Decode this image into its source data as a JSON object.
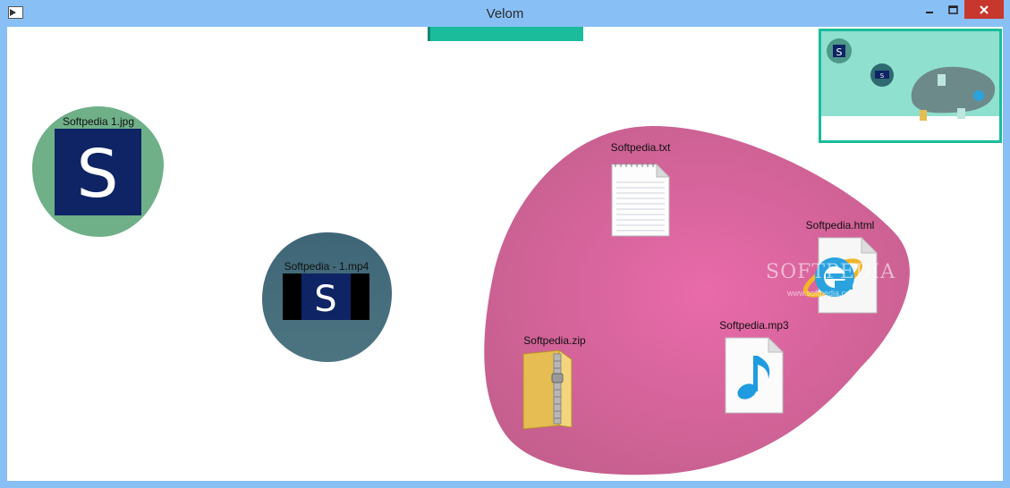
{
  "window": {
    "title": "Velom",
    "colors": {
      "titlebar": "#88bff5",
      "close": "#c7372e",
      "accent": "#1abc9c"
    }
  },
  "files": [
    {
      "name": "Softpedia 1.jpg",
      "icon": "jpg-image-thumbnail-icon",
      "group": "green-bubble"
    },
    {
      "name": "Softpedia - 1.mp4",
      "icon": "mp4-video-thumbnail-icon",
      "group": "teal-bubble"
    },
    {
      "name": "Softpedia.txt",
      "icon": "text-document-icon",
      "group": "pink-bubble"
    },
    {
      "name": "Softpedia.html",
      "icon": "internet-explorer-html-icon",
      "group": "pink-bubble"
    },
    {
      "name": "Softpedia.mp3",
      "icon": "music-note-file-icon",
      "group": "pink-bubble"
    },
    {
      "name": "Softpedia.zip",
      "icon": "zip-folder-icon",
      "group": "pink-bubble"
    }
  ],
  "bubbles": {
    "green": "#6fb088",
    "teal": "#3f6878",
    "pink": "#dd6aa6"
  },
  "watermark": {
    "brand": "SOFTPEDIA",
    "url": "www.softpedia.com"
  }
}
